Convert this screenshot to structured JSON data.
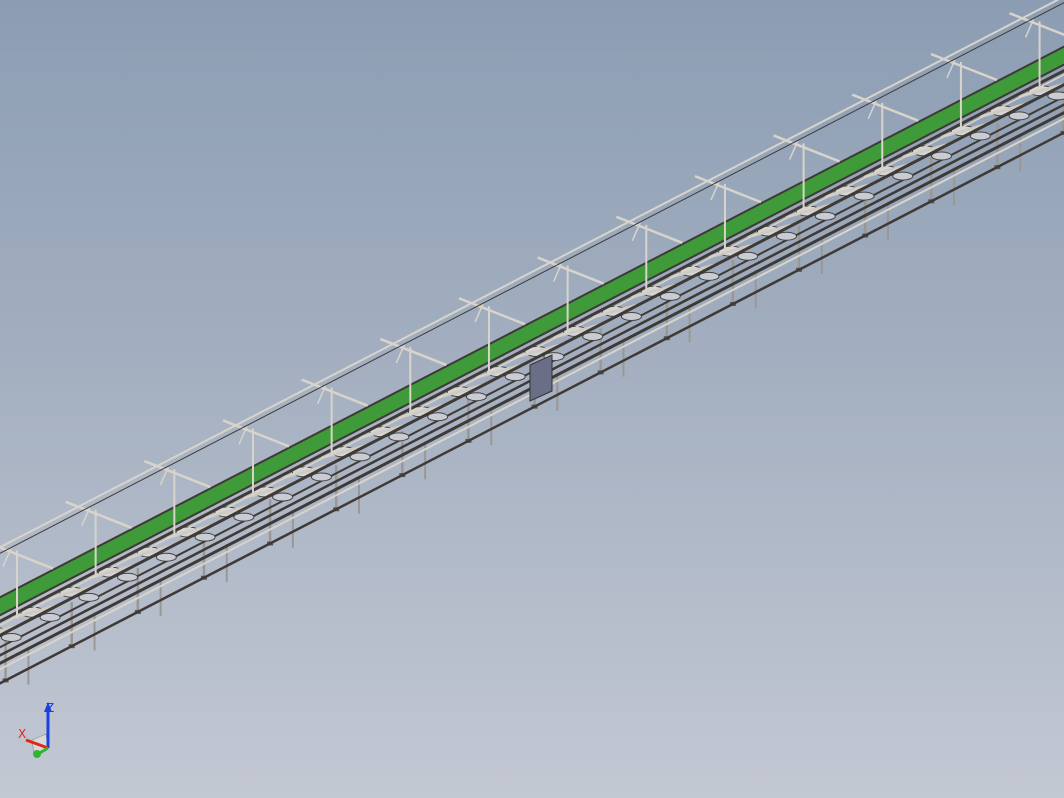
{
  "viewport": {
    "background_top": "#8c9db3",
    "background_bottom": "#c3c8d3"
  },
  "model": {
    "name": "assembly-line-conveyor",
    "colors": {
      "frame": "#3f3a36",
      "frame_light": "#d8d4cc",
      "guard_panel": "#3f9a3a",
      "guard_panel_dark": "#2d6e2b",
      "leg": "#9a9894",
      "control_box": "#6a6e86"
    },
    "workstation_count": 14,
    "upright_count": 14
  },
  "triad": {
    "x_label": "X",
    "z_label": "Z",
    "x_color": "#e0261b",
    "y_color": "#2fb52f",
    "z_color": "#1b3fe0"
  }
}
